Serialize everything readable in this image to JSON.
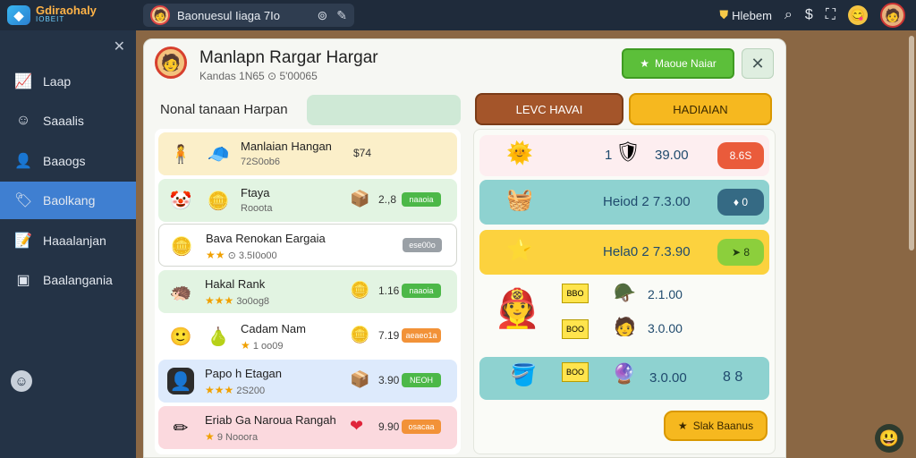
{
  "topbar": {
    "logo_mark": "◆",
    "logo_line1": "Gdiraohaly",
    "logo_line2": "IOBEIT",
    "search_text": "Baonuesul Iiaga 7Io",
    "coin_label": "Hlebem",
    "icons": [
      "search-icon",
      "dollar-icon",
      "fullscreen-icon"
    ]
  },
  "sidebar": {
    "items": [
      {
        "icon": "📈",
        "label": "Laap"
      },
      {
        "icon": "☺",
        "label": "Saaalis"
      },
      {
        "icon": "👤",
        "label": "Baaogs"
      },
      {
        "icon": "🏷",
        "label": "Baolkang"
      },
      {
        "icon": "📝",
        "label": "Haaalanjan"
      },
      {
        "icon": "▣",
        "label": "Baalangania"
      }
    ],
    "active_index": 3
  },
  "panel": {
    "title": "Manlapn Rargar Hargar",
    "subtitle": "Kandas 1N65 ⊙ 5'00065",
    "action_button": "Maoue Naiar",
    "left_label": "Nonal tanaan Harpan",
    "rows": [
      {
        "name": "Manlaian Hangan",
        "meta": "72S0ob6",
        "stars": "",
        "value": "$74",
        "tag": "",
        "ic1": "🧍",
        "ic2": "🧢",
        "val_icon": "",
        "bg": "#fbefc9",
        "tag_color": ""
      },
      {
        "name": "Ftaya",
        "meta": "Rooota",
        "stars": "",
        "value": "2.,8",
        "tag": "naaoia",
        "ic1": "🤡",
        "ic2": "🪙",
        "val_icon": "📦",
        "bg": "#e2f4e2",
        "tag_color": "#4cb848"
      },
      {
        "name": "Bava Renokan Eargaia",
        "meta": "⊙ 3.5I0o00",
        "stars": "★★",
        "value": "",
        "tag": "ese00o",
        "ic1": "🪙",
        "ic2": "",
        "val_icon": "",
        "bg": "#ffffff",
        "tag_color": "#9aa0a6"
      },
      {
        "name": "Hakal Rank",
        "meta": "3o0og8",
        "stars": "★★★",
        "value": "1.16",
        "tag": "naaoia",
        "ic1": "🦔",
        "ic2": "",
        "val_icon": "🪙",
        "bg": "#e2f4e2",
        "tag_color": "#4cb848"
      },
      {
        "name": "Cadam Nam",
        "meta": "1 oo09",
        "stars": "★",
        "value": "7.19",
        "tag": "aeaeo1a",
        "ic1": "🙂",
        "ic2": "🍐",
        "val_icon": "🪙",
        "bg": "#ffffff",
        "tag_color": "#f29238"
      },
      {
        "name": "Papo h Etagan",
        "meta": "2S200",
        "stars": "★★★",
        "value": "3.90",
        "tag": "NEOH",
        "ic1": "👤",
        "ic2": "",
        "val_icon": "📦",
        "bg": "#ddeafc",
        "tag_color": "#4cb848"
      },
      {
        "name": "Eriab Ga Naroua Rangah",
        "meta": "9 Nooora",
        "stars": "★",
        "value": "9.90",
        "tag": "osacaa",
        "ic1": "✏",
        "ic2": "",
        "val_icon": "❤",
        "bg": "#fbd9de",
        "tag_color": "#f29238"
      }
    ],
    "right_tab1": "LEVC HAVAI",
    "right_tab2": "HADIAIAN",
    "right": {
      "row1_num": "1",
      "row1_value": "39.00",
      "row1_btn": "8.6S",
      "row2_text": "Heiod 2 7.3.00",
      "row2_btn": "♦ 0",
      "row3_text": "Hela0 2 7.3.90",
      "row3_btn": "➤ 8",
      "tags": [
        "BBO",
        "BOO",
        "BOO"
      ],
      "vals": [
        "2.1.00",
        "3.0.00",
        "3.0.00"
      ],
      "row4_btn": "8 8",
      "star_button": "Slak Baanus"
    }
  }
}
